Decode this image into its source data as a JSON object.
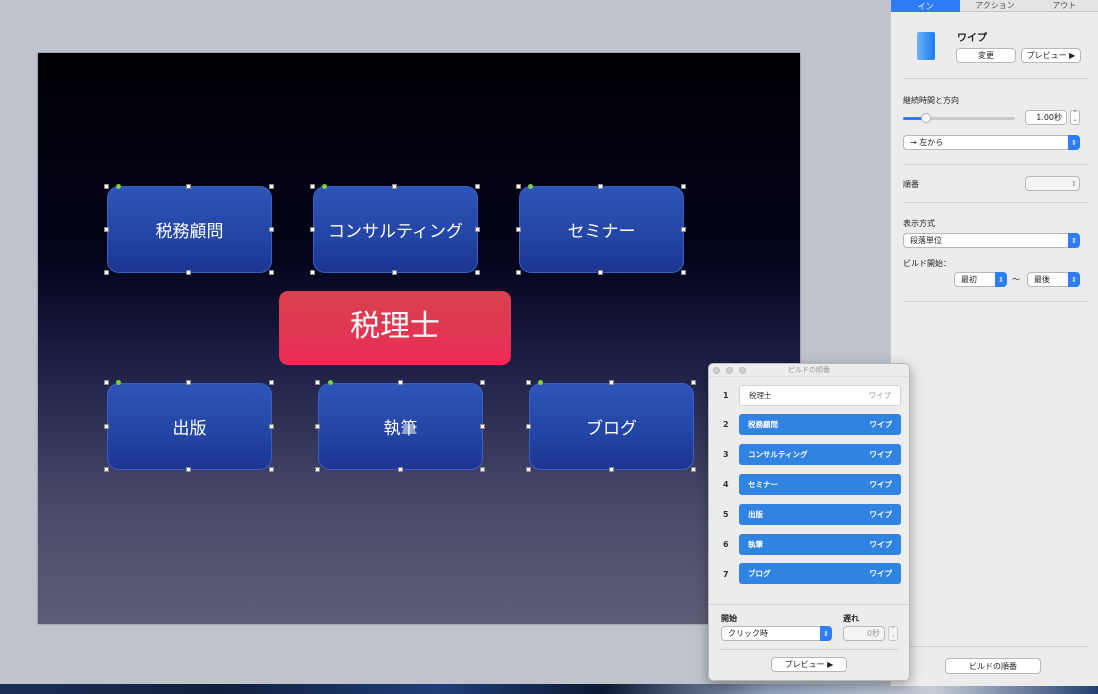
{
  "slide": {
    "boxes": [
      {
        "label": "税務顧問"
      },
      {
        "label": "コンサルティング"
      },
      {
        "label": "セミナー"
      },
      {
        "label": "出版"
      },
      {
        "label": "執筆"
      },
      {
        "label": "ブログ"
      }
    ],
    "center_label": "税理士"
  },
  "inspector": {
    "tabs": [
      "イン",
      "アクション",
      "アウト"
    ],
    "effect_name": "ワイプ",
    "change_button": "変更",
    "preview_button": "プレビュー ▶",
    "duration_title": "継続時間と方向",
    "duration_value": "1.00秒",
    "direction_value": "→  左から",
    "order_title": "順番",
    "display_title": "表示方式",
    "display_value": "段落単位",
    "build_start_label": "ビルド開始：",
    "build_from": "最初",
    "tilde": "〜",
    "build_to": "最後",
    "build_order_button": "ビルドの順番"
  },
  "build_window": {
    "title": "ビルドの順番",
    "rows": [
      {
        "num": "1",
        "label": "税理士",
        "effect": "ワイプ"
      },
      {
        "num": "2",
        "label": "税務顧問",
        "effect": "ワイプ"
      },
      {
        "num": "3",
        "label": "コンサルティング",
        "effect": "ワイプ"
      },
      {
        "num": "4",
        "label": "セミナー",
        "effect": "ワイプ"
      },
      {
        "num": "5",
        "label": "出版",
        "effect": "ワイプ"
      },
      {
        "num": "6",
        "label": "執筆",
        "effect": "ワイプ"
      },
      {
        "num": "7",
        "label": "ブログ",
        "effect": "ワイプ"
      }
    ],
    "start_label": "開始",
    "start_value": "クリック時",
    "delay_label": "遅れ",
    "delay_value": "0秒",
    "preview_button": "プレビュー  ▶"
  },
  "colors": {
    "accent": "#2f7df6",
    "box_blue": "#2345a4",
    "center_red": "#ea2d55",
    "selection_green": "#7bd241"
  }
}
